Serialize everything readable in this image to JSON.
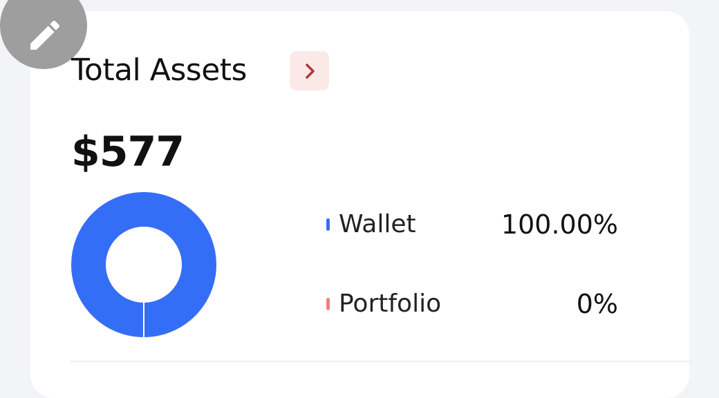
{
  "header": {
    "title": "Total Assets",
    "arrow_icon": "chevron-right-icon"
  },
  "edit_button": {
    "icon": "pencil-icon"
  },
  "summary": {
    "amount": "$577"
  },
  "allocation": {
    "items": [
      {
        "label": "Wallet",
        "value": "100.00%",
        "fraction": 1.0,
        "color": "#356ef6"
      },
      {
        "label": "Portfolio",
        "value": "0%",
        "fraction": 0.0,
        "color": "#f07f7a"
      }
    ]
  },
  "colors": {
    "background": "#f3f4f8",
    "card": "#ffffff",
    "accent_blue": "#356ef6",
    "accent_red": "#f07f7a",
    "arrow_bg": "#fbe9e8",
    "arrow_fg": "#b03a32",
    "fab_bg": "#9e9e9e"
  }
}
